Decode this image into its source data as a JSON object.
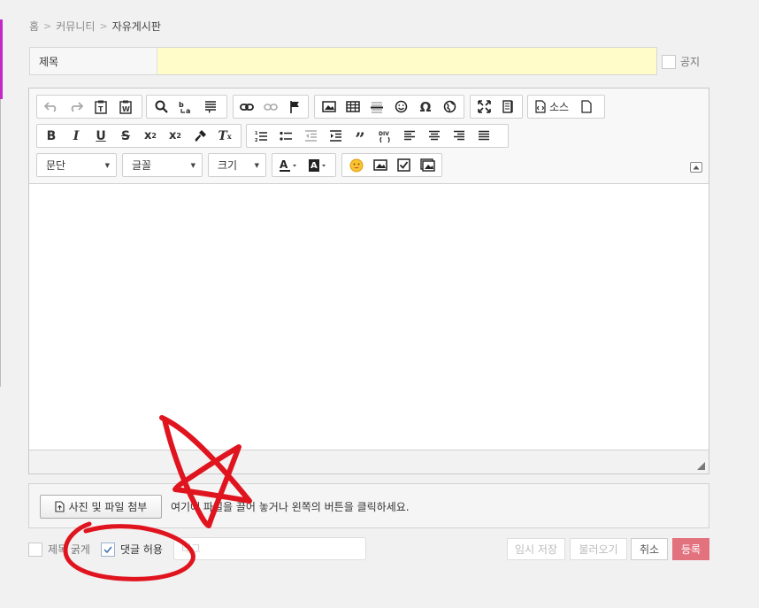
{
  "breadcrumb": {
    "home": "홈",
    "sep": ">",
    "community": "커뮤니티",
    "board": "자유게시판"
  },
  "title": {
    "label": "제목",
    "value": ""
  },
  "notice": {
    "label": "공지",
    "checked": false
  },
  "editor": {
    "combos": {
      "format": "문단",
      "font": "글꼴",
      "size": "크기"
    },
    "source_label": "소스"
  },
  "attach": {
    "button_label": "사진 및 파일 첨부",
    "help_text": "여기에 파일을 끌어 놓거나 왼쪽의 버튼을 클릭하세요."
  },
  "options": {
    "bold_title": {
      "label": "제목 굵게",
      "checked": false
    },
    "allow_comments": {
      "label": "댓글 허용",
      "checked": true
    }
  },
  "tag": {
    "placeholder": "태그"
  },
  "buttons": {
    "temp_save": "임시 저장",
    "load": "불러오기",
    "cancel": "취소",
    "submit": "등록"
  },
  "colors": {
    "accent": "#c428c7",
    "title_bg": "#fffcc9",
    "submit_bg": "#e3727f",
    "annotation": "#e0141e"
  }
}
